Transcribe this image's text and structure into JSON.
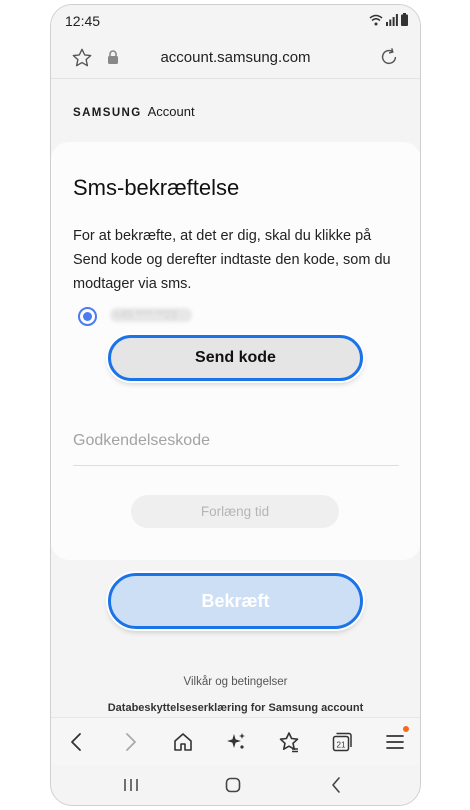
{
  "status_bar": {
    "time": "12:45"
  },
  "browser": {
    "url": "account.samsung.com"
  },
  "brand": {
    "wordmark": "SAMSUNG",
    "suffix": "Account"
  },
  "card": {
    "title": "Sms-bekræftelse",
    "description": "For at bekræfte, at det er dig, skal du klikke på Send kode og derefter indtaste den kode, som du modtager via sms.",
    "phone_masked": "+45 **** **23",
    "send_button": "Send kode",
    "code_placeholder": "Godkendelseskode",
    "extend_button": "Forlæng tid"
  },
  "confirm_button": "Bekræft",
  "footer": {
    "terms": "Vilkår og betingelser",
    "privacy": "Databeskyttelseserklæring for Samsung account"
  },
  "toolbar": {
    "tabs_count": "21"
  },
  "colors": {
    "accent": "#1a73e8",
    "radio": "#4a7cf0",
    "confirm_bg": "#cddff4"
  }
}
